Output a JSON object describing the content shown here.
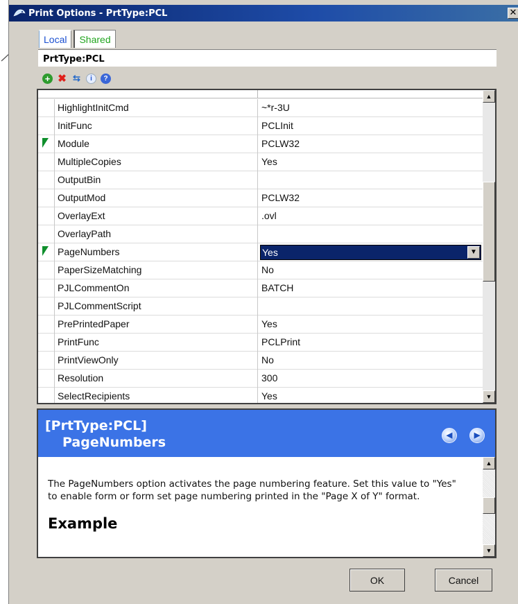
{
  "window": {
    "title": "Print Options - PrtType:PCL",
    "close_glyph": "✕"
  },
  "tabs": [
    {
      "label": "Local"
    },
    {
      "label": "Shared"
    }
  ],
  "header": {
    "label": "PrtType:PCL"
  },
  "toolbar": {
    "icons": [
      "add-icon",
      "delete-icon",
      "move-icon",
      "info-icon",
      "help-icon"
    ],
    "add_glyph": "+",
    "delete_glyph": "✖",
    "move_glyph": "⇆",
    "info_glyph": "i",
    "help_glyph": "?"
  },
  "grid": {
    "rows": [
      {
        "name": "HighlightInitCmd",
        "value": "~*r-3U"
      },
      {
        "name": "InitFunc",
        "value": "PCLInit"
      },
      {
        "name": "Module",
        "value": "PCLW32"
      },
      {
        "name": "MultipleCopies",
        "value": "Yes"
      },
      {
        "name": "OutputBin",
        "value": ""
      },
      {
        "name": "OutputMod",
        "value": "PCLW32"
      },
      {
        "name": "OverlayExt",
        "value": ".ovl"
      },
      {
        "name": "OverlayPath",
        "value": ""
      },
      {
        "name": "PageNumbers",
        "value": "Yes"
      },
      {
        "name": "PaperSizeMatching",
        "value": "No"
      },
      {
        "name": "PJLCommentOn",
        "value": "BATCH"
      },
      {
        "name": "PJLCommentScript",
        "value": ""
      },
      {
        "name": "PrePrintedPaper",
        "value": "Yes"
      },
      {
        "name": "PrintFunc",
        "value": "PCLPrint"
      },
      {
        "name": "PrintViewOnly",
        "value": "No"
      },
      {
        "name": "Resolution",
        "value": "300"
      },
      {
        "name": "SelectRecipients",
        "value": "Yes"
      }
    ],
    "scroll_up_glyph": "▲",
    "scroll_down_glyph": "▼",
    "dropdown_glyph": "▼"
  },
  "help": {
    "title_line1": "[PrtType:PCL]",
    "title_line2": "PageNumbers",
    "prev_glyph": "◀",
    "next_glyph": "▶",
    "body": "The PageNumbers option activates the page numbering feature. Set this value to \"Yes\" to enable form or form set page numbering printed in the \"Page X of Y\" format.",
    "example_heading": "Example"
  },
  "buttons": {
    "ok": "OK",
    "cancel": "Cancel"
  },
  "colors": {
    "title_bar": "#0a246a",
    "help_banner": "#3b73e6",
    "selection": "#0a246a",
    "marker": "#0f8f2c"
  }
}
